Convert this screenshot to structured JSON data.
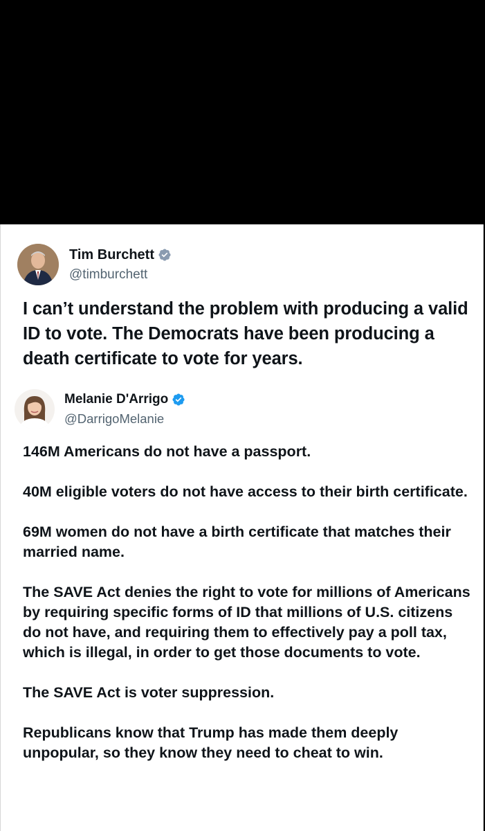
{
  "tweet_original": {
    "display_name": "Tim Burchett",
    "handle": "@timburchett",
    "verified_icon": "verified-badge-icon",
    "text": "I can’t understand the problem with producing a valid ID to vote. The Democrats have been producing a death certificate to vote for years."
  },
  "tweet_reply": {
    "display_name": "Melanie D'Arrigo",
    "handle": "@DarrigoMelanie",
    "verified_icon": "verified-badge-icon",
    "paragraphs": [
      "146M Americans do not have a passport.",
      "40M eligible voters do not have access to their birth certificate.",
      "69M women do not have a birth certificate that matches their married name.",
      "The SAVE Act denies the right to vote for millions of Americans by requiring specific forms of ID that millions of U.S. citizens do not have, and requiring them to effectively pay a poll tax, which is illegal, in order to get those documents to vote.",
      "The SAVE Act is voter suppression.",
      "Republicans know that Trump has made them deeply unpopular, so they know they need to cheat to win."
    ]
  },
  "colors": {
    "verified_badge": "#8a9bb0",
    "verified_badge_blue": "#1d9bf0",
    "text_primary": "#0f1419",
    "text_secondary": "#536471"
  }
}
